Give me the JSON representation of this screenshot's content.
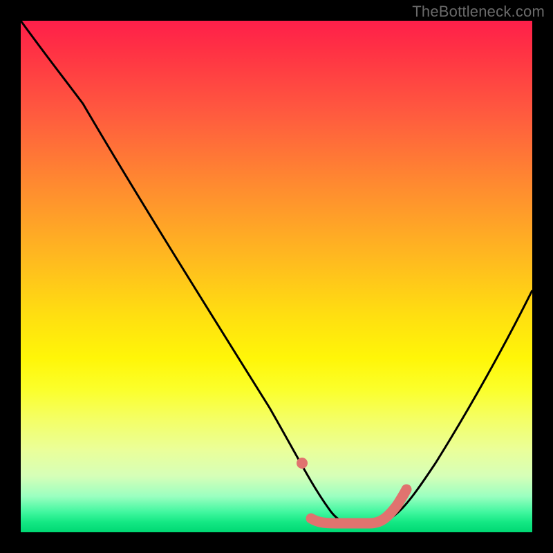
{
  "watermark": "TheBottleneck.com",
  "colors": {
    "page_bg": "#000000",
    "curve_stroke": "#000000",
    "highlight_stroke": "#e0736f",
    "gradient_top": "#ff1f4a",
    "gradient_bottom": "#00d873"
  },
  "chart_data": {
    "type": "line",
    "title": "",
    "xlabel": "",
    "ylabel": "",
    "xlim": [
      0,
      100
    ],
    "ylim": [
      0,
      100
    ],
    "note": "Values are approximate, read off pixel positions; y=0 is bottom (green band), y=100 is top (red).",
    "series": [
      {
        "name": "bottleneck-curve",
        "x": [
          0,
          5,
          10,
          15,
          20,
          25,
          30,
          35,
          40,
          45,
          50,
          53,
          56,
          60,
          64,
          68,
          70,
          74,
          78,
          82,
          86,
          90,
          94,
          98,
          100
        ],
        "y": [
          100,
          95,
          89,
          83,
          76,
          69,
          61,
          53,
          44,
          35,
          25,
          17,
          9,
          4,
          2,
          2,
          2,
          4,
          9,
          16,
          24,
          32,
          40,
          48,
          52
        ]
      },
      {
        "name": "optimal-range-highlight",
        "x": [
          53,
          56,
          60,
          64,
          68,
          70
        ],
        "y": [
          17,
          9,
          4,
          2,
          2,
          2
        ]
      }
    ]
  }
}
